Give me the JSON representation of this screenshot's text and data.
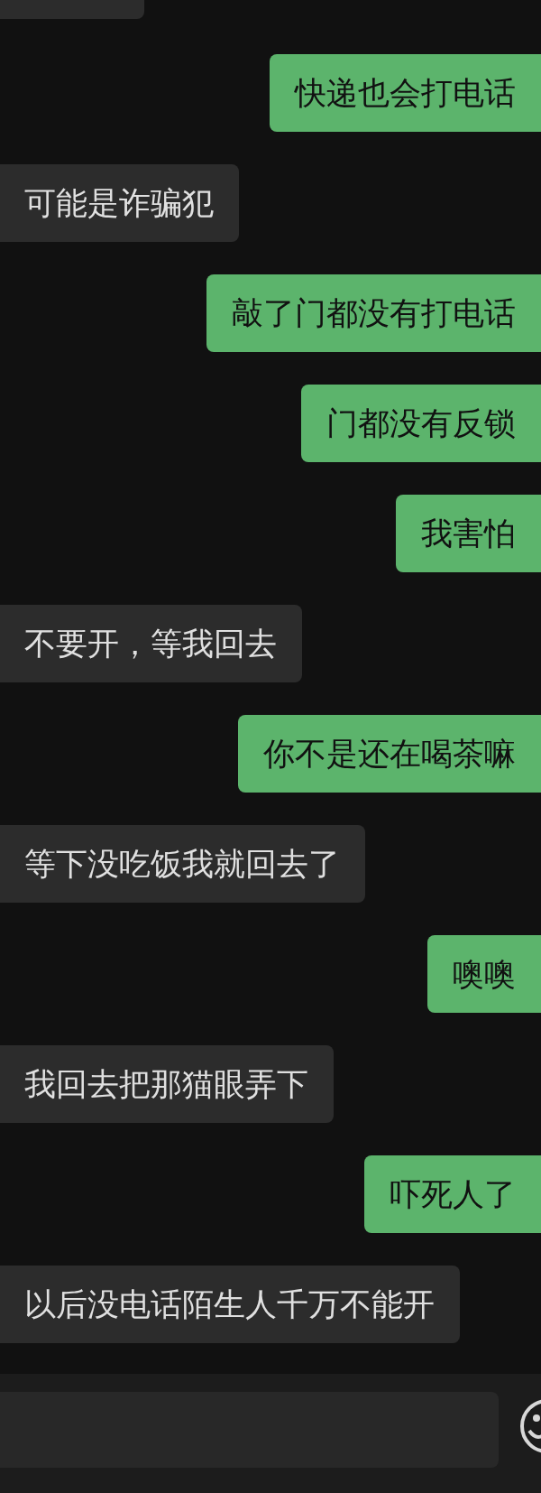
{
  "messages": [
    {
      "kind": "received"
    },
    {
      "kind": "sent",
      "text": "快递也会打电话"
    },
    {
      "kind": "received",
      "text": "可能是诈骗犯"
    },
    {
      "kind": "sent",
      "text": "敲了门都没有打电话"
    },
    {
      "kind": "sent",
      "text": "门都没有反锁"
    },
    {
      "kind": "sent",
      "text": "我害怕"
    },
    {
      "kind": "received",
      "text": "不要开，等我回去"
    },
    {
      "kind": "sent",
      "text": "你不是还在喝茶嘛"
    },
    {
      "kind": "received",
      "text": "等下没吃饭我就回去了"
    },
    {
      "kind": "sent",
      "text": "噢噢"
    },
    {
      "kind": "received",
      "text": "我回去把那猫眼弄下"
    },
    {
      "kind": "sent",
      "text": "吓死人了"
    },
    {
      "kind": "received",
      "text": "以后没电话陌生人千万不能开"
    }
  ]
}
